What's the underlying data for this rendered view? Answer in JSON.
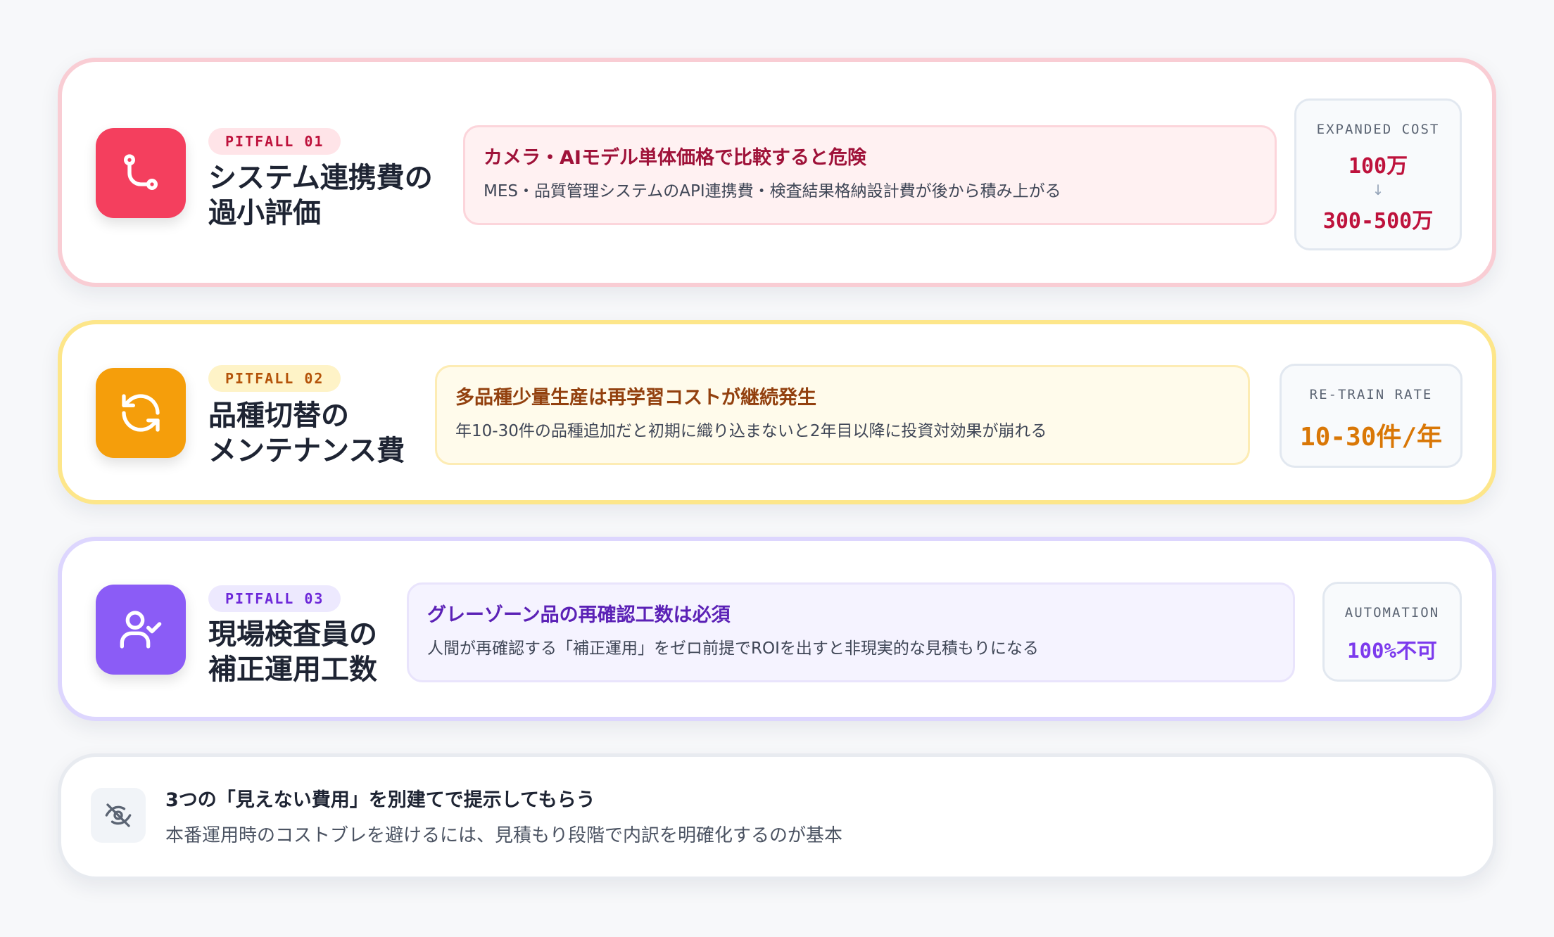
{
  "pitfalls": [
    {
      "tag": "PITFALL 01",
      "title_line1": "システム連携費の",
      "title_line2": "過小評価",
      "icon": "git-branch-icon",
      "accent": "#f43f5e",
      "callout_head": "カメラ・AIモデル単体価格で比較すると危険",
      "callout_body": "MES・品質管理システムのAPI連携費・検査結果格納設計費が後から積み上がる",
      "metric_label": "EXPANDED COST",
      "metric_from": "100万",
      "metric_arrow": "↓",
      "metric_to": "300-500万"
    },
    {
      "tag": "PITFALL 02",
      "title_line1": "品種切替の",
      "title_line2": "メンテナンス費",
      "icon": "refresh-icon",
      "accent": "#f59e0b",
      "callout_head": "多品種少量生産は再学習コストが継続発生",
      "callout_body": "年10-30件の品種追加だと初期に織り込まないと2年目以降に投資対効果が崩れる",
      "metric_label": "RE-TRAIN RATE",
      "metric_value": "10-30件/年"
    },
    {
      "tag": "PITFALL 03",
      "title_line1": "現場検査員の",
      "title_line2": "補正運用工数",
      "icon": "user-check-icon",
      "accent": "#8b5cf6",
      "callout_head": "グレーゾーン品の再確認工数は必須",
      "callout_body": "人間が再確認する「補正運用」をゼロ前提でROIを出すと非現実的な見積もりになる",
      "metric_label": "AUTOMATION",
      "metric_value": "100%不可"
    }
  ],
  "note": {
    "icon": "eye-off-icon",
    "head": "3つの「見えない費用」を別建てで提示してもらう",
    "body": "本番運用時のコストブレを避けるには、見積もり段階で内訳を明確化するのが基本"
  }
}
